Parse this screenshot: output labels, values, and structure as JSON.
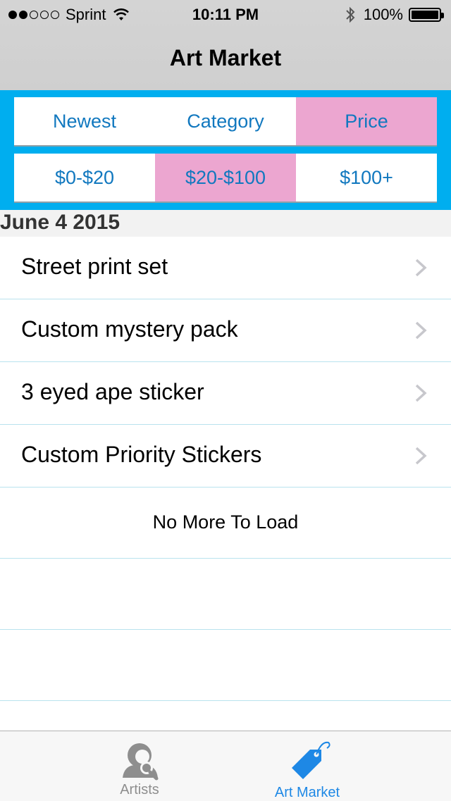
{
  "status_bar": {
    "carrier": "Sprint",
    "time": "10:11 PM",
    "battery": "100%",
    "signal_dots_filled": 2,
    "signal_dots_total": 5
  },
  "nav": {
    "title": "Art Market"
  },
  "filters": {
    "sort_tabs": [
      {
        "label": "Newest",
        "active": false
      },
      {
        "label": "Category",
        "active": false
      },
      {
        "label": "Price",
        "active": true
      }
    ],
    "price_tabs": [
      {
        "label": "$0-$20",
        "active": false
      },
      {
        "label": "$20-$100",
        "active": true
      },
      {
        "label": "$100+",
        "active": false
      }
    ]
  },
  "section": {
    "title": "June 4 2015"
  },
  "items": [
    {
      "label": "Street print set"
    },
    {
      "label": "Custom mystery pack"
    },
    {
      "label": "3 eyed ape sticker"
    },
    {
      "label": "Custom Priority Stickers"
    }
  ],
  "load_more": {
    "label": "No More To Load"
  },
  "tab_bar": {
    "tabs": [
      {
        "label": "Artists",
        "icon": "artists-icon",
        "active": false
      },
      {
        "label": "Art Market",
        "icon": "price-tag-icon",
        "active": true
      }
    ]
  },
  "colors": {
    "accent_blue": "#00aeef",
    "active_pink": "#eca6d0",
    "link_blue": "#1178bf",
    "tab_active": "#1e88e5",
    "tab_inactive": "#8e8e8e"
  }
}
